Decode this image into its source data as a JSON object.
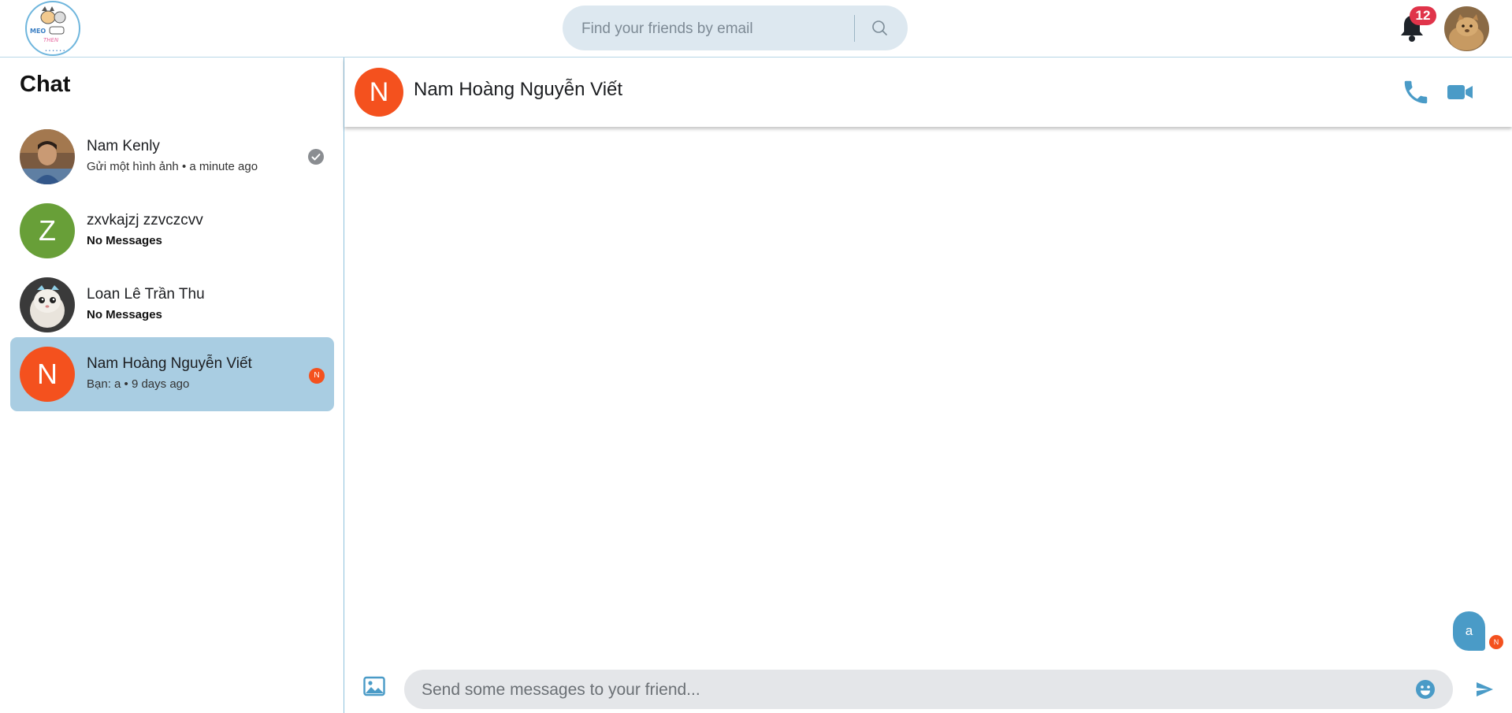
{
  "header": {
    "logo_alt": "MEO THEN",
    "search_placeholder": "Find your friends by email",
    "notification_count": "12",
    "colors": {
      "accent": "#4a9bc7",
      "badge": "#e0344a"
    }
  },
  "sidebar": {
    "title": "Chat",
    "conversations": [
      {
        "name": "Nam Kenly",
        "sub": "Gửi một hình ảnh • a minute ago",
        "avatar": "photo",
        "status": "seen-check-icon"
      },
      {
        "name": "zxvkajzj zzvczcvv",
        "sub": "No Messages",
        "avatar_letter": "Z",
        "avatar_color": "#689f38"
      },
      {
        "name": "Loan Lê Trần Thu",
        "sub": "No Messages",
        "avatar": "photo"
      },
      {
        "name": "Nam Hoàng Nguyễn Viết",
        "sub": "Bạn: a • 9 days ago",
        "avatar_letter": "N",
        "avatar_color": "#f4511e",
        "seen_letter": "N",
        "active": true
      }
    ]
  },
  "chat": {
    "header_letter": "N",
    "header_name": "Nam Hoàng Nguyễn Viết",
    "messages": [
      {
        "text": "a",
        "seen_by_letter": "N"
      }
    ],
    "input_placeholder": "Send some messages to your friend..."
  }
}
